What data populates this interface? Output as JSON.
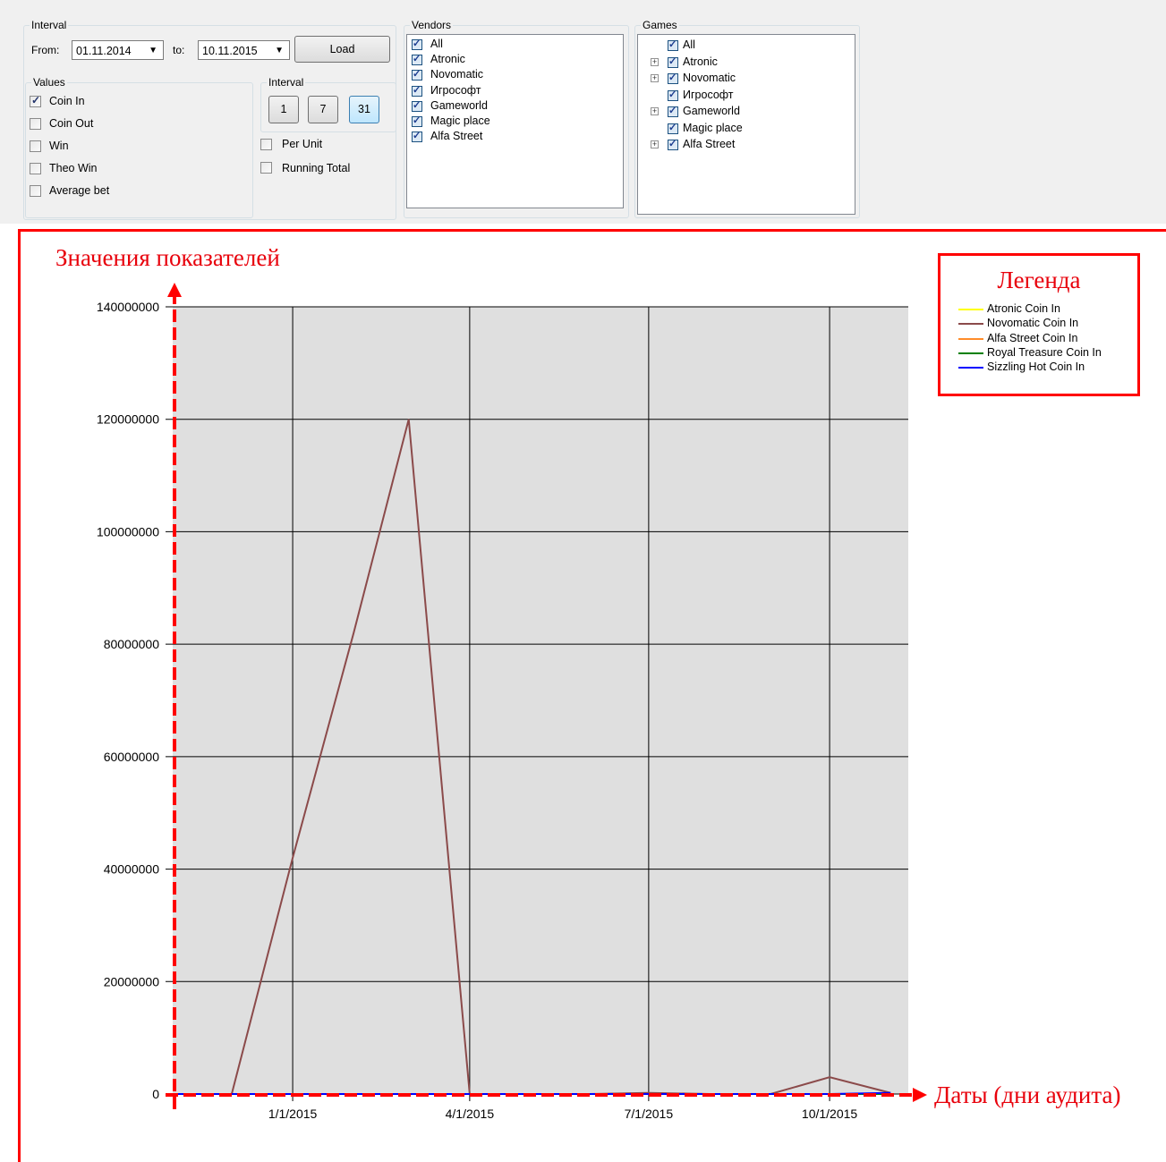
{
  "interval_group": {
    "title": "Interval",
    "from_label": "From:",
    "from_value": "01.11.2014",
    "to_label": "to:",
    "to_value": "10.11.2015",
    "load_label": "Load"
  },
  "values_group": {
    "title": "Values",
    "items": [
      {
        "label": "Coin In",
        "checked": true
      },
      {
        "label": "Coin Out",
        "checked": false
      },
      {
        "label": "Win",
        "checked": false
      },
      {
        "label": "Theo Win",
        "checked": false
      },
      {
        "label": "Average bet",
        "checked": false
      }
    ]
  },
  "step_group": {
    "title": "Interval",
    "buttons": [
      "1",
      "7",
      "31"
    ],
    "active": "31"
  },
  "options": {
    "per_unit": "Per Unit",
    "running_total": "Running Total"
  },
  "vendors": {
    "title": "Vendors",
    "items": [
      "All",
      "Atronic",
      "Novomatic",
      "Игрософт",
      "Gameworld",
      "Magic place",
      "Alfa Street"
    ]
  },
  "games": {
    "title": "Games",
    "items": [
      {
        "label": "All",
        "expandable": false
      },
      {
        "label": "Atronic",
        "expandable": true
      },
      {
        "label": "Novomatic",
        "expandable": true
      },
      {
        "label": "Игрософт",
        "expandable": false
      },
      {
        "label": "Gameworld",
        "expandable": true
      },
      {
        "label": "Magic place",
        "expandable": false
      },
      {
        "label": "Alfa Street",
        "expandable": true
      }
    ]
  },
  "annotations": {
    "y_axis": "Значения показателей",
    "x_axis": "Даты (дни аудита)",
    "legend_title": "Легенда"
  },
  "colors": {
    "plot_bg": "#dfdfdf",
    "annotation_red": "#ff0000",
    "novomatic": "#8b4a4a"
  },
  "chart_data": {
    "type": "line",
    "x_tick_labels": [
      "1/1/2015",
      "4/1/2015",
      "7/1/2015",
      "10/1/2015"
    ],
    "y_tick_labels": [
      "0",
      "20000000",
      "40000000",
      "60000000",
      "80000000",
      "100000000",
      "120000000",
      "140000000"
    ],
    "ylim": [
      0,
      140000000
    ],
    "xlim": [
      "2014-11-01",
      "2015-11-10"
    ],
    "x": [
      "2014-11-01",
      "2014-12-01",
      "2015-01-01",
      "2015-02-01",
      "2015-03-01",
      "2015-04-01",
      "2015-05-01",
      "2015-06-01",
      "2015-07-01",
      "2015-08-01",
      "2015-09-01",
      "2015-10-01",
      "2015-11-01"
    ],
    "series": [
      {
        "name": "Atronic Coin In",
        "color": "#ffff00",
        "values": [
          0,
          0,
          0,
          0,
          0,
          0,
          0,
          0,
          0,
          0,
          0,
          0,
          0
        ]
      },
      {
        "name": "Novomatic Coin In",
        "color": "#8b4a4a",
        "values": [
          0,
          0,
          42000000,
          82000000,
          120000000,
          0,
          0,
          0,
          200000,
          0,
          0,
          3000000,
          200000
        ]
      },
      {
        "name": "Alfa Street Coin In",
        "color": "#ff8c2a",
        "values": [
          0,
          0,
          0,
          0,
          0,
          0,
          0,
          0,
          0,
          0,
          0,
          0,
          0
        ]
      },
      {
        "name": "Royal Treasure Coin In",
        "color": "#008000",
        "values": [
          0,
          0,
          0,
          0,
          0,
          0,
          0,
          0,
          0,
          0,
          0,
          0,
          0
        ]
      },
      {
        "name": "Sizzling Hot Coin In",
        "color": "#0000ff",
        "values": [
          0,
          0,
          0,
          0,
          0,
          0,
          0,
          0,
          0,
          0,
          0,
          0,
          200000
        ]
      }
    ],
    "grid": true,
    "legend_position": "top-right"
  }
}
